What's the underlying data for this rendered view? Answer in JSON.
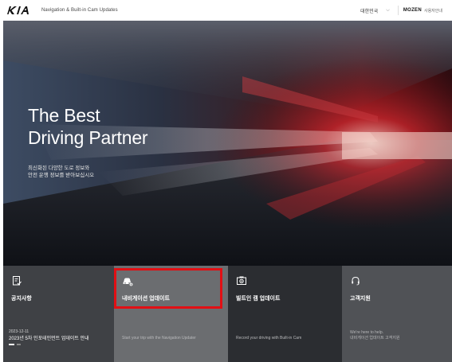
{
  "header": {
    "title": "Navigation & Built-in Cam Updates",
    "language": "대한민국",
    "partner_brand": "MOZEN",
    "partner_sub": "사용자안내"
  },
  "hero": {
    "title": "The Best\nDriving Partner",
    "description": "최신화된 다양한 도로 정보와\n안전 운행 정보를 받아보십시오"
  },
  "cards": [
    {
      "title": "공지사항",
      "date": "2023-12-11",
      "notice": "2023년 5차 인포테인먼트 업데이트 안내",
      "icon": "notice-icon"
    },
    {
      "title": "내비게이션 업데이트",
      "desc": "Start your trip with the Navigation Updater",
      "icon": "car-update-icon"
    },
    {
      "title": "빌트인 캠 업데이트",
      "desc": "Record your driving with Built-in Cam",
      "icon": "camera-icon"
    },
    {
      "title": "고객지원",
      "desc": "We're here to help.\n내비게이션 업데이트 고객지원",
      "icon": "headset-icon"
    }
  ],
  "colors": {
    "highlight": "#e20f14",
    "card_notice": "#3f4145",
    "card_nav": "#6b6d70",
    "card_cam": "#2b2d31",
    "card_support": "#505256"
  }
}
